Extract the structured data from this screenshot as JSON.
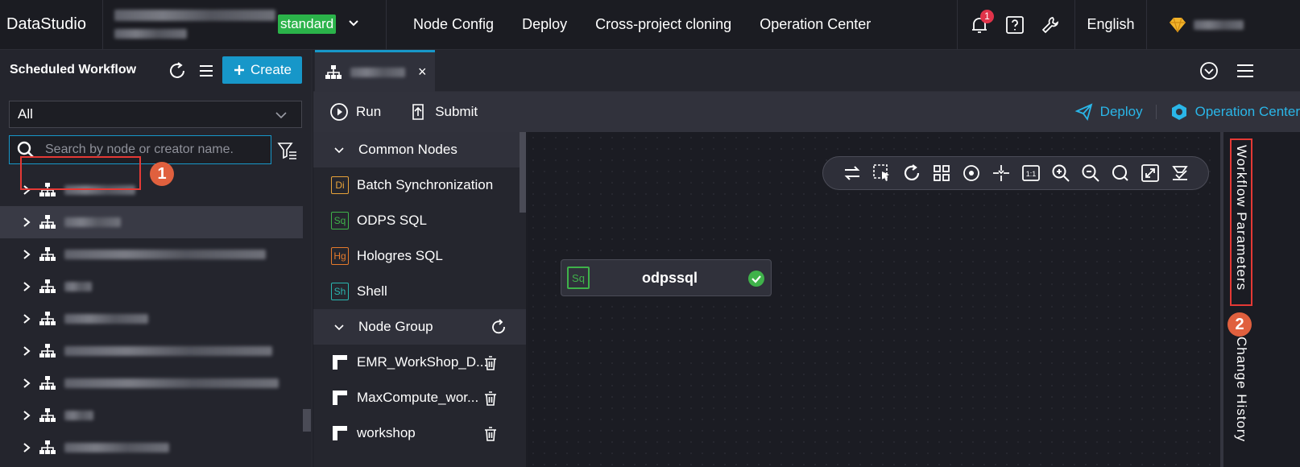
{
  "topbar": {
    "brand": "DataStudio",
    "env_badge": "standard",
    "nav": [
      "Node Config",
      "Deploy",
      "Cross-project cloning",
      "Operation Center"
    ],
    "notification_count": "1",
    "language": "English"
  },
  "sidebar": {
    "title": "Scheduled Workflow",
    "create_label": "Create",
    "filter_value": "All",
    "search_placeholder": "Search by node or creator name.",
    "workflow_rows": 9
  },
  "tabs": [
    {
      "close": "×"
    }
  ],
  "toolbar": {
    "run_label": "Run",
    "submit_label": "Submit",
    "deploy_label": "Deploy",
    "ops_label": "Operation Center"
  },
  "palette": {
    "common_header": "Common Nodes",
    "common_nodes": [
      {
        "badge": "Di",
        "label": "Batch Synchronization",
        "color": "#e8a33a"
      },
      {
        "badge": "Sq",
        "label": "ODPS SQL",
        "color": "#3fb24a"
      },
      {
        "badge": "Hg",
        "label": "Hologres SQL",
        "color": "#e57a2c"
      },
      {
        "badge": "Sh",
        "label": "Shell",
        "color": "#2ab6b0"
      }
    ],
    "group_header": "Node Group",
    "groups": [
      "EMR_WorkShop_D...",
      "MaxCompute_wor...",
      "workshop"
    ]
  },
  "canvas": {
    "node": {
      "badge": "Sq",
      "name": "odpssql"
    }
  },
  "right_panel": {
    "params_label": "Workflow Parameters",
    "history_label": "Change History"
  },
  "callouts": [
    "1",
    "2"
  ],
  "colors": {
    "accent": "#1797c9",
    "env": "#2bb34a",
    "highlight": "#e53935",
    "callout": "#e0603e",
    "link": "#2ab6e8"
  }
}
